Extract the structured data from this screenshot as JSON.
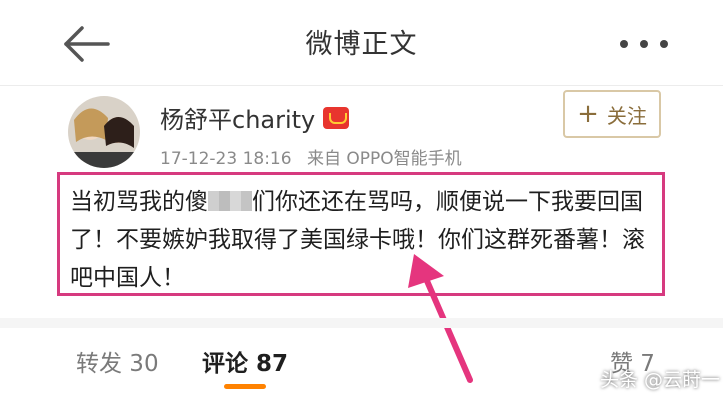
{
  "header": {
    "title": "微博正文",
    "back_icon": "back-arrow-icon",
    "more_icon": "more-dots-icon"
  },
  "user": {
    "name": "杨舒平charity",
    "badge_icon": "vip-red-envelope-icon",
    "time": "17-12-23 18:16",
    "source": "来自 OPPO智能手机",
    "follow_label": "关注"
  },
  "post": {
    "text_before_mosaic": "当初骂我的傻",
    "text_after_mosaic": "们你还还在骂吗，顺便说一下我要回国了！不要嫉妒我取得了美国绿卡哦！你们这群死番薯！滚吧中国人！",
    "highlight_color": "#d63a7f"
  },
  "tabs": {
    "repost": "转发 30",
    "comment": "评论 87",
    "like": "赞 7",
    "accent_color": "#ff8200"
  },
  "watermark": "头条 @云莳一"
}
